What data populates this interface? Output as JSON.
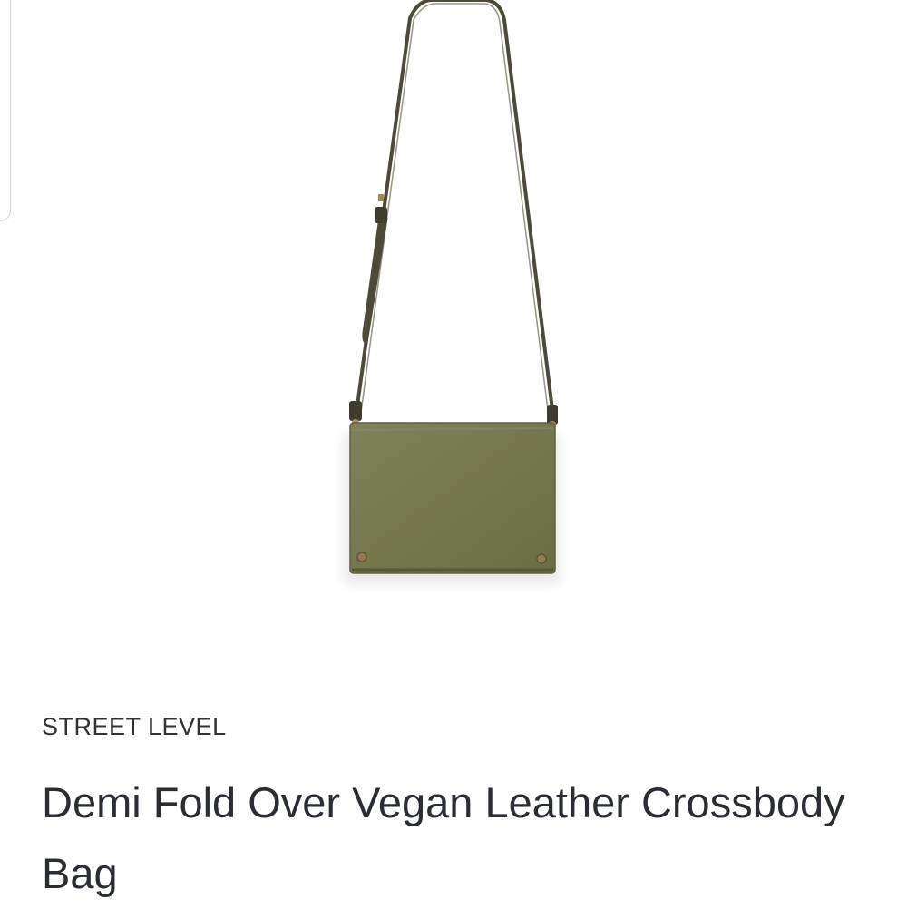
{
  "product": {
    "brand": "STREET LEVEL",
    "name": "Demi Fold Over Vegan Leather Crossbody Bag",
    "image_icon": "crossbody-bag-image",
    "bag_color": "#777a4e",
    "strap_color": "#4d4a37"
  }
}
